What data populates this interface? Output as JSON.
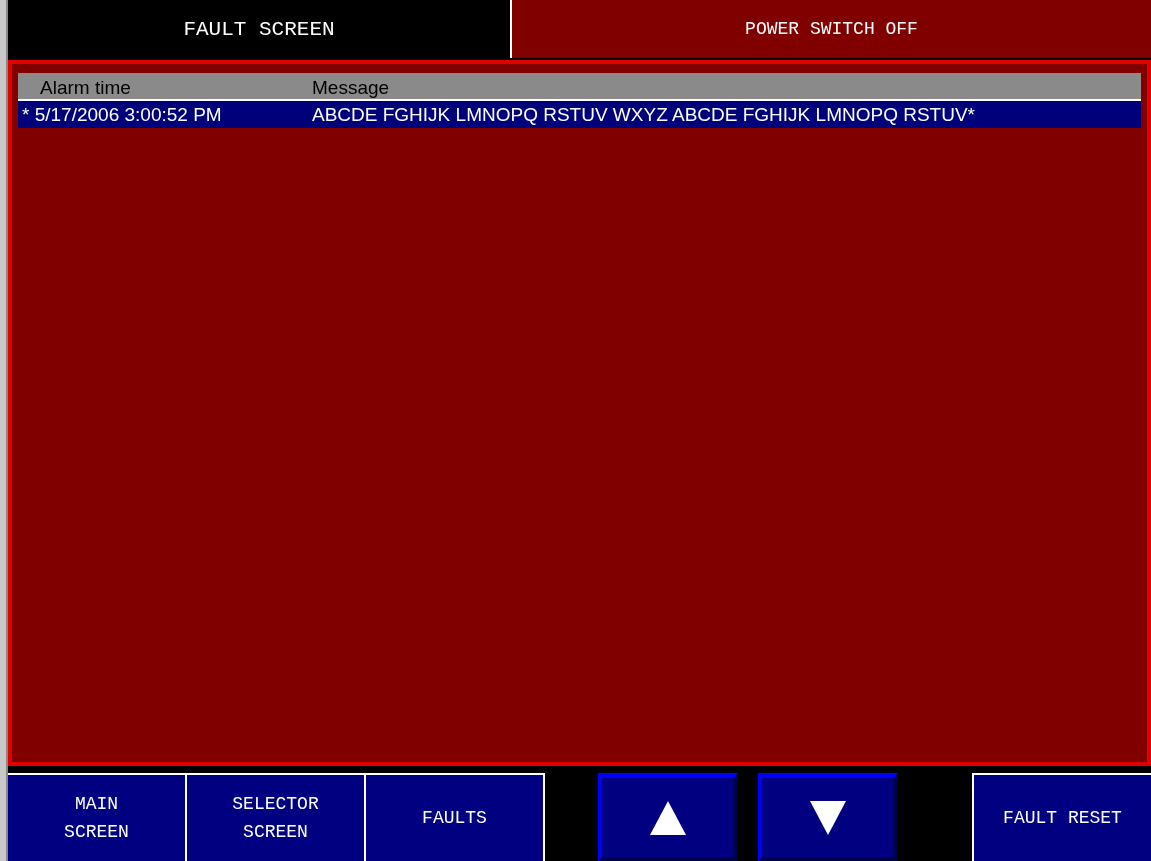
{
  "header": {
    "title": "FAULT SCREEN",
    "status": "POWER SWITCH OFF"
  },
  "table": {
    "columns": [
      "Alarm time",
      "Message"
    ],
    "rows": [
      {
        "time": "* 5/17/2006 3:00:52 PM",
        "message": "ABCDE FGHIJK LMNOPQ RSTUV WXYZ ABCDE FGHIJK LMNOPQ RSTUV*",
        "selected": true
      }
    ]
  },
  "nav_buttons": [
    {
      "label": "MAIN\nSCREEN"
    },
    {
      "label": "SELECTOR\nSCREEN"
    },
    {
      "label": "FAULTS"
    }
  ],
  "scroll_buttons": [
    {
      "kind": "up"
    },
    {
      "kind": "down"
    }
  ],
  "reset_button": {
    "label": "FAULT RESET"
  }
}
